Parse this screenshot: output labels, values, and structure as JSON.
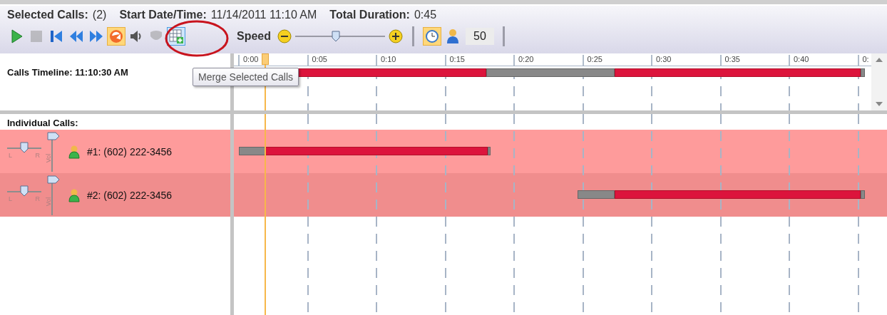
{
  "header": {
    "selected_calls_label": "Selected Calls:",
    "selected_calls": "(2)",
    "start_label": "Start Date/Time:",
    "start": "11/14/2011 11:10 AM",
    "duration_label": "Total Duration:",
    "duration": "0:45"
  },
  "toolbar": {
    "buttons": [
      {
        "kind": "play",
        "pressed": false,
        "hovered": false,
        "disabled": false
      },
      {
        "kind": "stop",
        "pressed": false,
        "hovered": false,
        "disabled": true
      },
      {
        "kind": "skip-start",
        "pressed": false,
        "hovered": false,
        "disabled": false
      },
      {
        "kind": "rewind",
        "pressed": false,
        "hovered": false,
        "disabled": false
      },
      {
        "kind": "fast-forward",
        "pressed": false,
        "hovered": false,
        "disabled": false
      },
      {
        "kind": "loop",
        "pressed": true,
        "hovered": false,
        "disabled": false
      },
      {
        "kind": "speaker",
        "pressed": false,
        "hovered": false,
        "disabled": false
      },
      {
        "kind": "shield",
        "pressed": false,
        "hovered": false,
        "disabled": true
      },
      {
        "kind": "merge",
        "pressed": false,
        "hovered": true,
        "disabled": false
      }
    ],
    "speed": {
      "label": "Speed",
      "level": 0.45
    },
    "clock": {
      "pressed": true
    },
    "count": "50"
  },
  "tooltip": "Merge Selected Calls",
  "timeline": {
    "label": "Calls Timeline: 11:10:30 AM",
    "ticks": [
      "0:00",
      "0:05",
      "0:10",
      "0:15",
      "0:20",
      "0:25",
      "0:30",
      "0:35",
      "0:40",
      "0:"
    ]
  },
  "individual": {
    "title": "Individual Calls:",
    "calls": [
      {
        "label": "#1: (602) 222-3456",
        "pan_left": "L",
        "pan_right": "R",
        "vol_label": "Vol",
        "pan": {
          "level": 0.5
        },
        "volume": {
          "level": 1
        }
      },
      {
        "label": "#2: (602) 222-3456",
        "pan_left": "L",
        "pan_right": "R",
        "vol_label": "Vol",
        "pan": {
          "level": 0.5
        },
        "volume": {
          "level": 1
        }
      }
    ]
  }
}
